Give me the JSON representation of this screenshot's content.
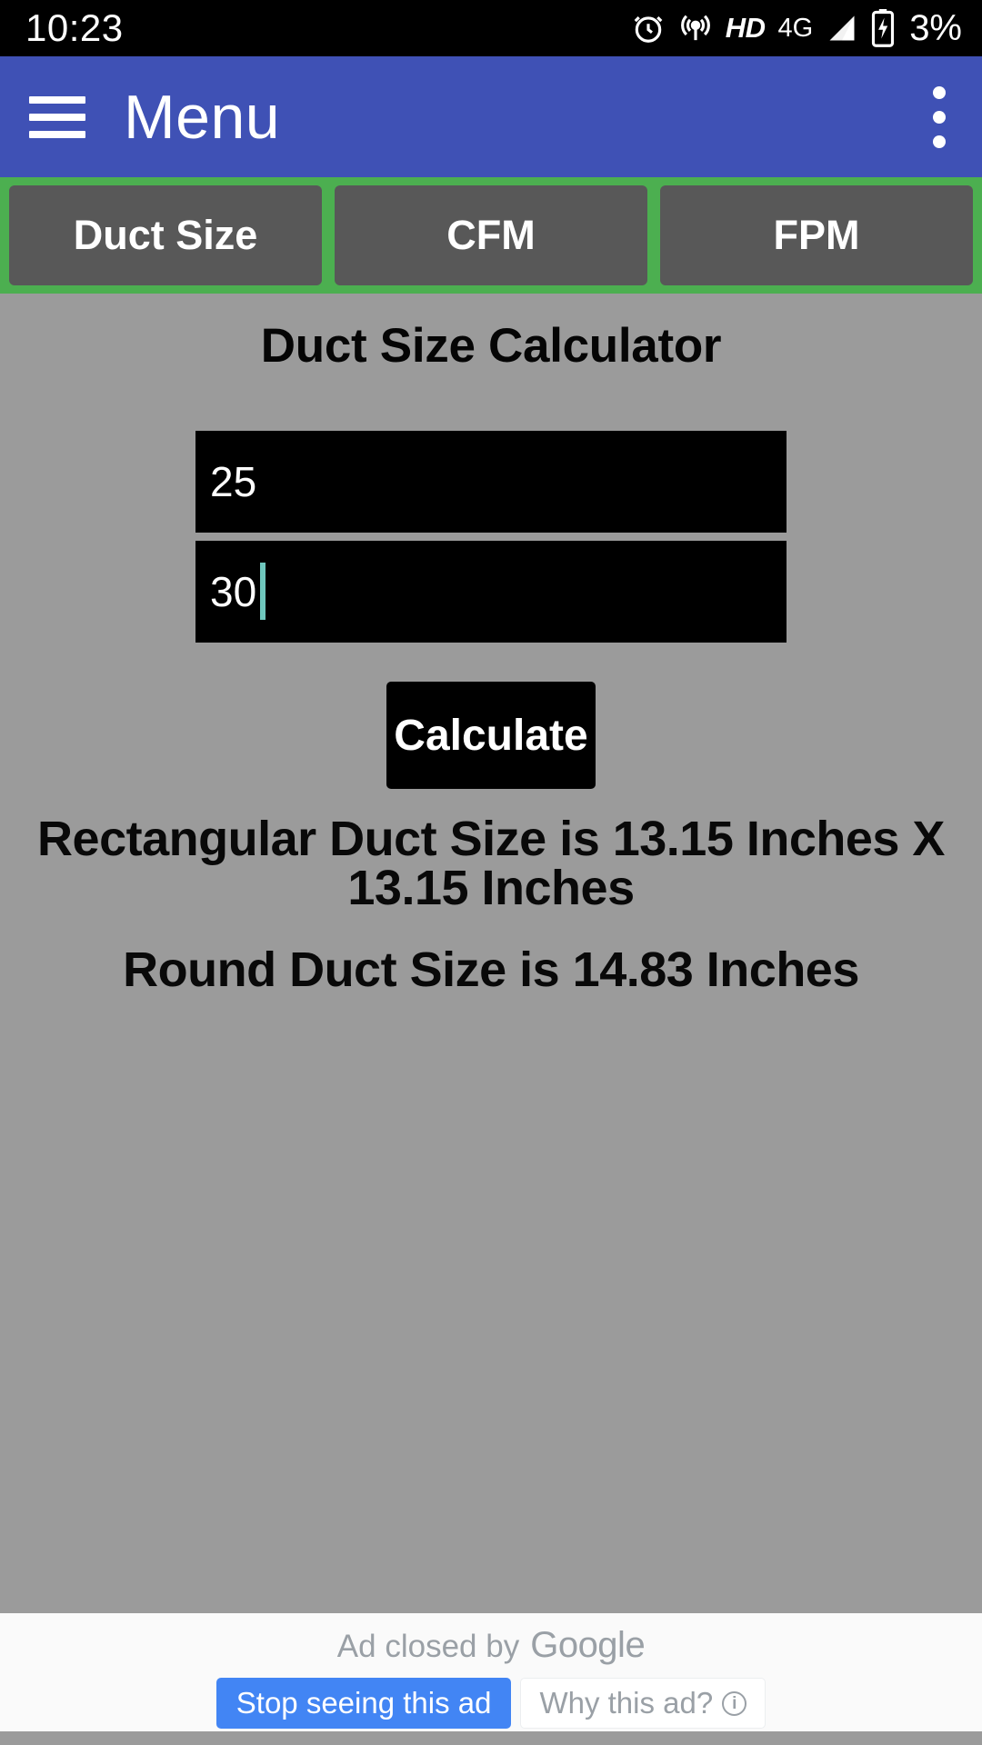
{
  "status_bar": {
    "time": "10:23",
    "battery_percent": "3%",
    "hd_label": "HD",
    "network_label": "4G",
    "icons": [
      "alarm-icon",
      "hotspot-icon",
      "hd-icon",
      "network-4g-icon",
      "signal-icon",
      "battery-charging-icon"
    ]
  },
  "app_bar": {
    "title": "Menu",
    "menu_icon": "hamburger-menu-icon",
    "overflow_icon": "overflow-dots-icon",
    "background_color": "#3f51b5"
  },
  "tabs": {
    "background_color": "#4caf50",
    "button_color": "#585858",
    "items": [
      {
        "label": "Duct Size"
      },
      {
        "label": "CFM"
      },
      {
        "label": "FPM"
      }
    ]
  },
  "main": {
    "title": "Duct Size Calculator",
    "background_color": "#9b9b9b",
    "inputs": [
      {
        "name": "width-input",
        "value": "25",
        "placeholder": ""
      },
      {
        "name": "height-input",
        "value": "30",
        "placeholder": "",
        "caret": true
      }
    ],
    "calculate_button": "Calculate",
    "results": {
      "rectangular": "Rectangular Duct Size is 13.15 Inches X 13.15 Inches",
      "round": "Round Duct Size is 14.83 Inches"
    }
  },
  "ad": {
    "closed_text": "Ad closed by",
    "brand": "Google",
    "stop_button": "Stop seeing this ad",
    "why_button": "Why this ad?",
    "info_glyph": "i",
    "accent_color": "#4285f4"
  }
}
